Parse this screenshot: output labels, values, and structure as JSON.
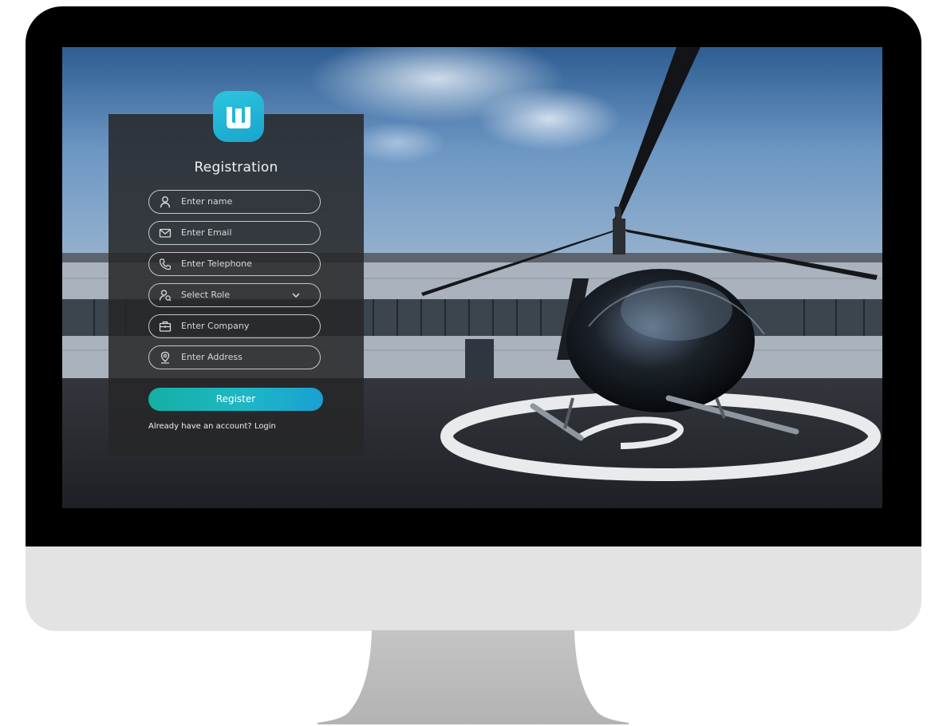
{
  "form": {
    "title": "Registration",
    "fields": [
      {
        "placeholder": "Enter name",
        "icon": "user-icon"
      },
      {
        "placeholder": "Enter Email",
        "icon": "envelope-icon"
      },
      {
        "placeholder": "Enter Telephone",
        "icon": "phone-icon"
      },
      {
        "placeholder": "Select Role",
        "icon": "role-icon"
      },
      {
        "placeholder": "Enter Company",
        "icon": "briefcase-icon"
      },
      {
        "placeholder": "Enter Address",
        "icon": "location-pin-icon"
      }
    ],
    "register_label": "Register",
    "login_text": "Already have an account? Login"
  },
  "logo": {
    "icon": "w-logo-icon"
  },
  "colors": {
    "accent_start": "#14b0a4",
    "accent_end": "#1aa0d3",
    "logo": "#22b5d8",
    "panel": "#262628"
  }
}
